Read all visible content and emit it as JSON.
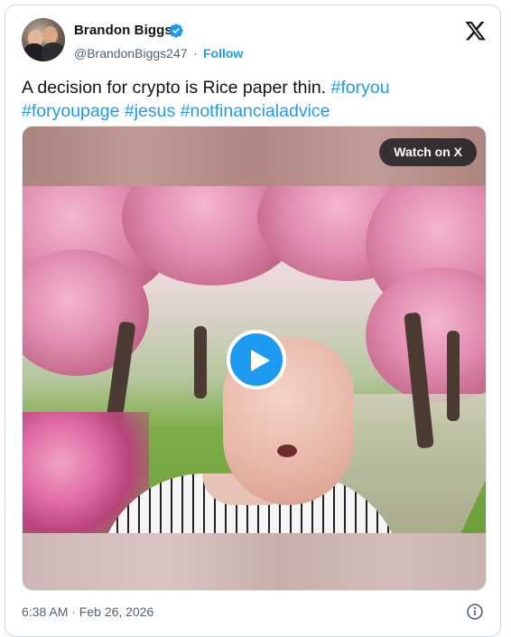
{
  "author": {
    "name": "Brandon Biggs",
    "handle": "@BrandonBiggs247",
    "separator": "·",
    "follow_label": "Follow",
    "verified": true,
    "accent_color": "#1d9bf0"
  },
  "tweet": {
    "text_plain": "A decision for crypto is Rice paper thin. ",
    "hashtags": [
      "#foryou",
      "#foryoupage",
      "#jesus",
      "#notfinancialadvice"
    ],
    "timestamp": "6:38 AM · Feb 26, 2026"
  },
  "media": {
    "watch_label": "Watch on X",
    "play_icon": "play-icon"
  },
  "icons": {
    "platform": "x-logo-icon",
    "verified": "verified-badge-icon",
    "info": "info-icon"
  }
}
